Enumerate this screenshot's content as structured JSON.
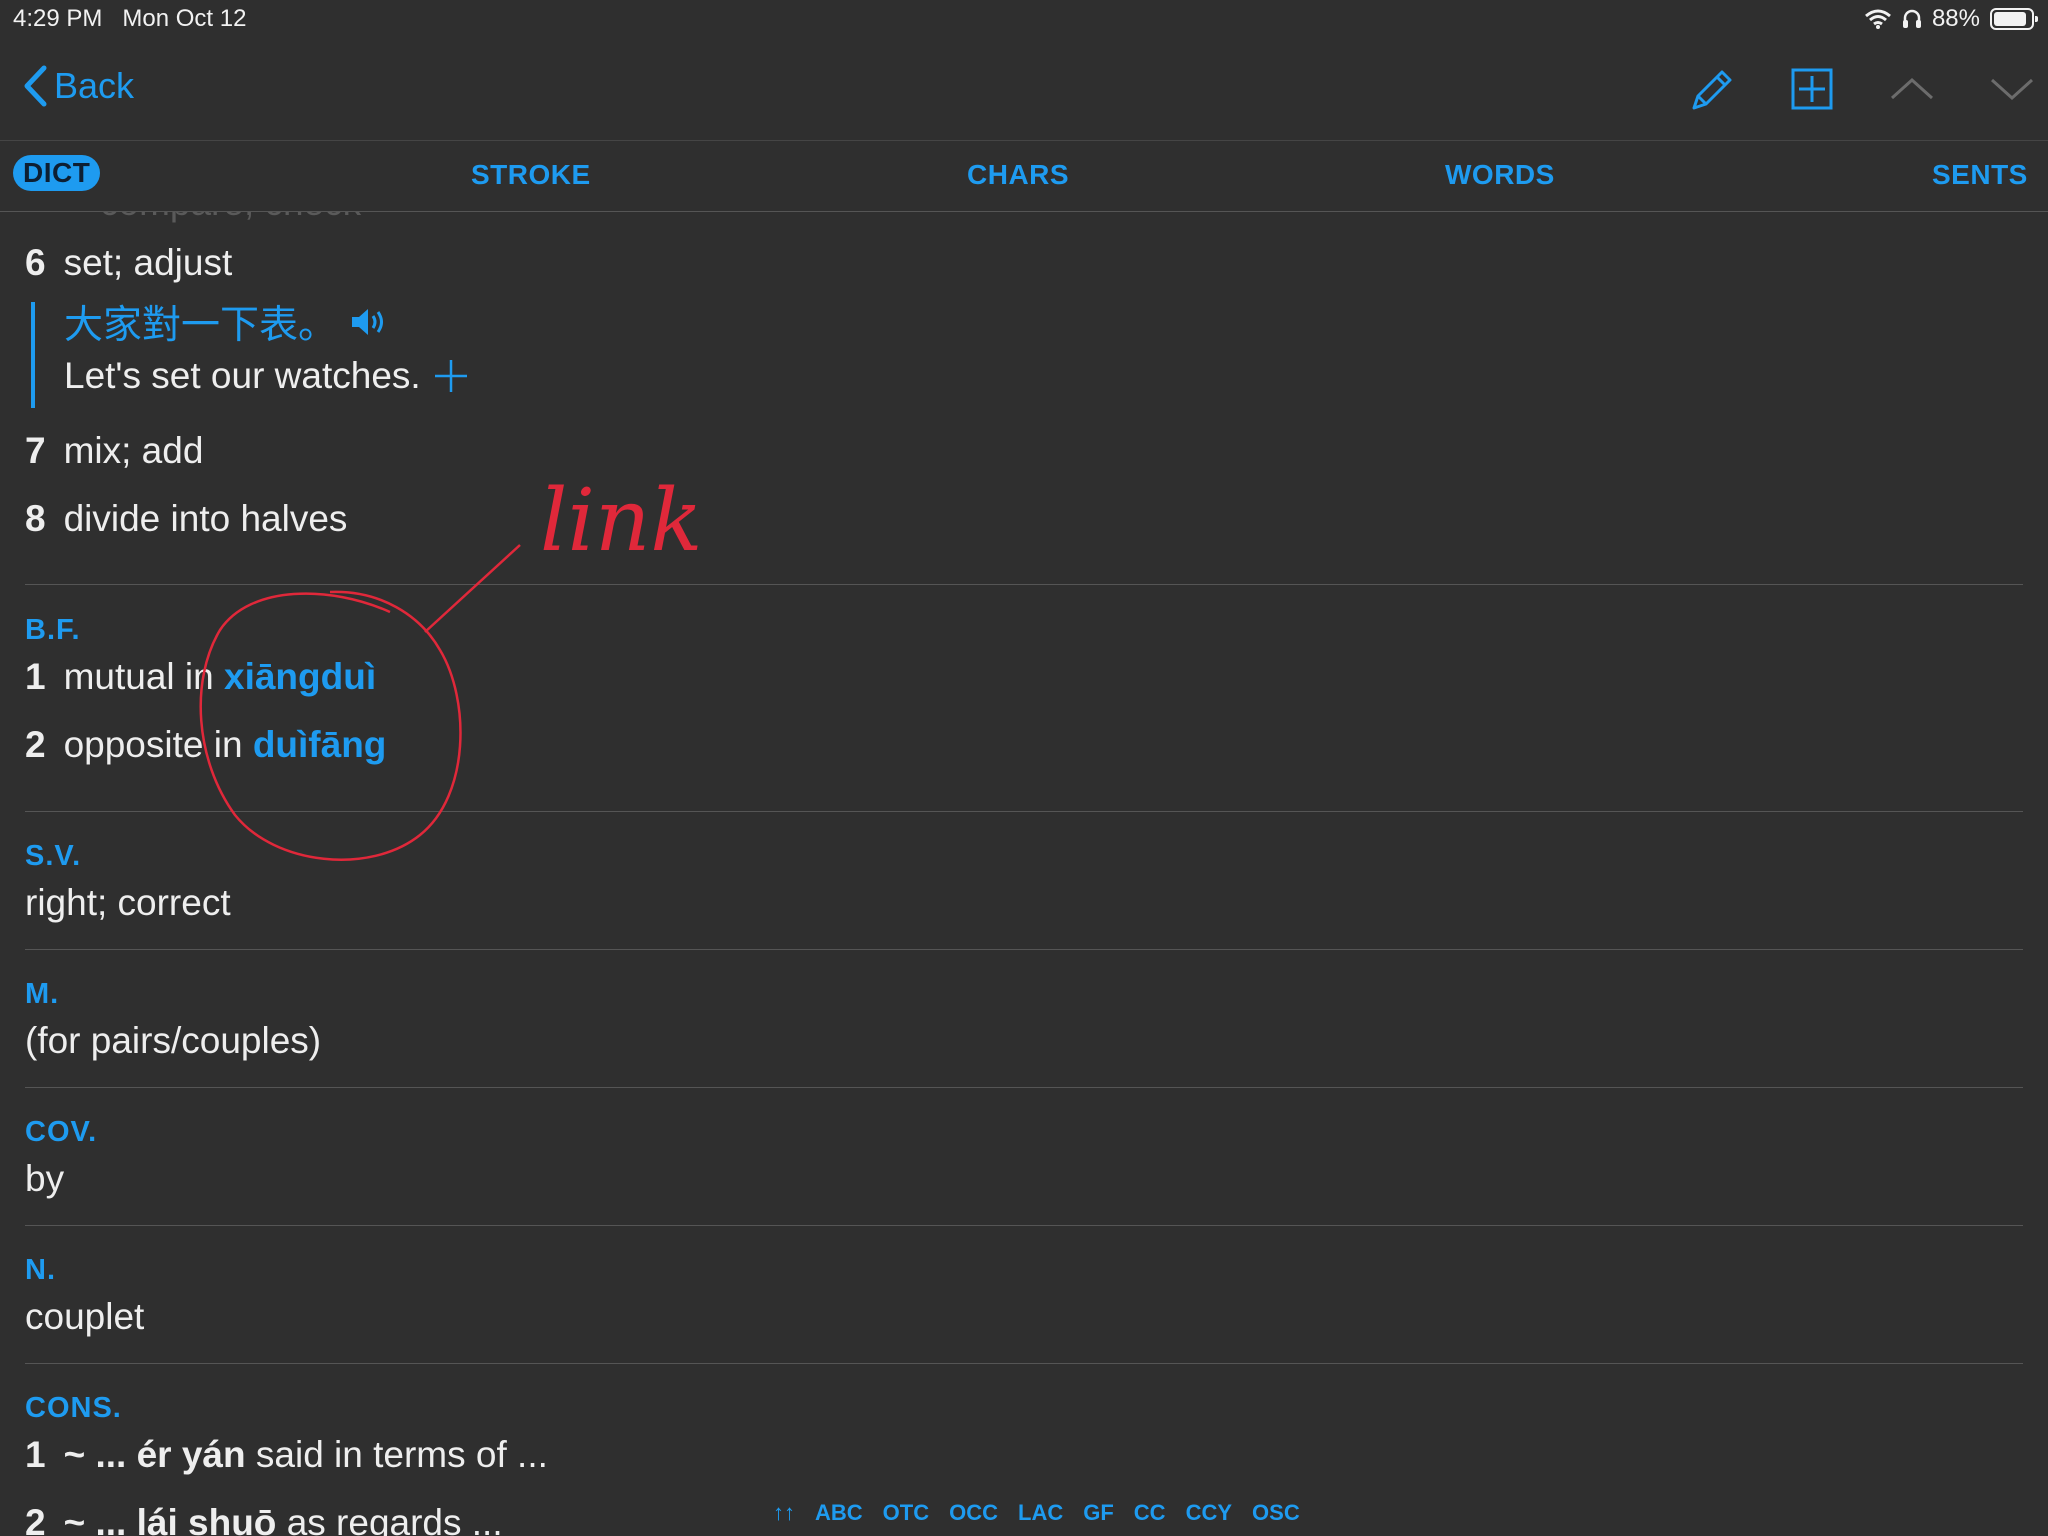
{
  "status": {
    "time": "4:29 PM",
    "date": "Mon Oct 12",
    "battery": "88%"
  },
  "nav": {
    "back": "Back"
  },
  "tabs": [
    "DICT",
    "STROKE",
    "CHARS",
    "WORDS",
    "SENTS"
  ],
  "faded_text": "compare; check",
  "defs": [
    {
      "num": "6",
      "text": "set; adjust"
    },
    {
      "num": "7",
      "text": "mix; add"
    },
    {
      "num": "8",
      "text": "divide into halves"
    }
  ],
  "example": {
    "zh": "大家對一下表。",
    "en": "Let's set our watches."
  },
  "sections": {
    "bf": {
      "label": "B.F.",
      "items": [
        {
          "num": "1",
          "text": "mutual in",
          "link": "xiāngduì"
        },
        {
          "num": "2",
          "text": "opposite in",
          "link": "duìfāng"
        }
      ]
    },
    "sv": {
      "label": "S.V.",
      "text": "right; correct"
    },
    "m": {
      "label": "M.",
      "text": "(for pairs/couples)"
    },
    "cov": {
      "label": "COV.",
      "text": "by"
    },
    "n": {
      "label": "N.",
      "text": "couplet"
    },
    "cons": {
      "label": "CONS.",
      "items": [
        {
          "num": "1",
          "prefix": "~ ...",
          "pinyin": "ér yán",
          "text": "said in terms of ..."
        },
        {
          "num": "2",
          "prefix": "~ ...",
          "pinyin": "lái shuō",
          "text": "as regards ..."
        }
      ]
    }
  },
  "bottom_index": [
    "↑↑",
    "ABC",
    "OTC",
    "OCC",
    "LAC",
    "GF",
    "CC",
    "CCY",
    "OSC"
  ],
  "annotation": {
    "text": "link"
  },
  "colors": {
    "accent": "#1e9bf0",
    "background": "#2f2f2f",
    "annotation": "#e0283a"
  }
}
